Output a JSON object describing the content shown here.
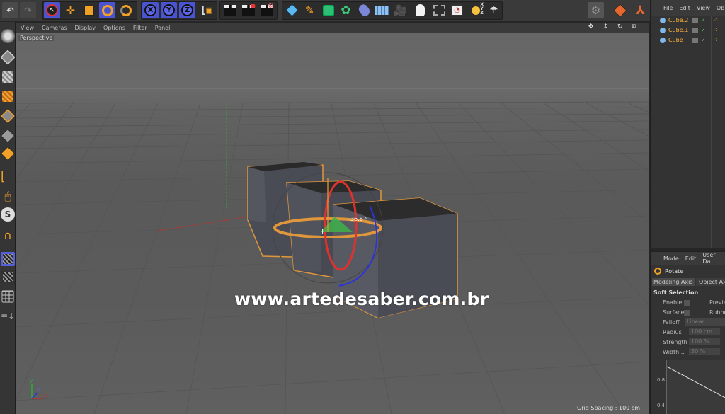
{
  "viewport": {
    "menu": [
      "View",
      "Cameras",
      "Display",
      "Options",
      "Filter",
      "Panel"
    ],
    "camera_label": "Perspective",
    "grid_spacing": "Grid Spacing : 100 cm",
    "rotation_readout": "-36.8 °",
    "watermark": "www.artedesaber.com.br",
    "axis_labels": [
      "x",
      "y",
      "z"
    ],
    "nav_icons": [
      "move-view-icon",
      "zoom-view-icon",
      "rotate-view-icon",
      "maximize-view-icon"
    ]
  },
  "toolbar": {
    "icons": [
      "undo-icon",
      "redo-icon",
      "live-selection-icon",
      "move-icon",
      "scale-icon",
      "rotate-icon",
      "recent-tool-icon",
      "x-axis-icon",
      "y-axis-icon",
      "z-axis-icon",
      "coordinate-system-icon",
      "render-view-icon",
      "render-picture-viewer-icon",
      "render-settings-icon",
      "cube-primitive-icon",
      "pen-spline-icon",
      "subdivision-surface-icon",
      "cloner-icon",
      "deformer-icon",
      "floor-icon",
      "camera-icon",
      "light-icon",
      "texture-tag-icon",
      "scene-icon",
      "xyz-icon",
      "material-icon",
      "layout-icon",
      "object-icon",
      "axis-icon"
    ],
    "axis_letters": [
      "X",
      "Y",
      "Z"
    ]
  },
  "left_toolbar": {
    "icons": [
      "make-editable-icon",
      "texture-mode-icon",
      "workplane-icon",
      "points-mode-icon",
      "edges-mode-icon",
      "polygons-mode-icon",
      "axis-mode-icon",
      "tweak-mode-icon",
      "snap-icon",
      "magnet-icon",
      "lock-workplane-icon",
      "solo-icon",
      "grid-icon",
      "stack-icon"
    ]
  },
  "object_manager": {
    "menu": [
      "File",
      "Edit",
      "View",
      "Ob"
    ],
    "objects": [
      {
        "name": "Cube.2"
      },
      {
        "name": "Cube.1"
      },
      {
        "name": "Cube"
      }
    ]
  },
  "attribute_manager": {
    "menu": [
      "Mode",
      "Edit",
      "User Da"
    ],
    "tool_name": "Rotate",
    "tabs": [
      "Modeling Axis",
      "Object Ax"
    ],
    "section": "Soft Selection",
    "fields": [
      {
        "label": "Enable",
        "value": "",
        "extra": "Previe"
      },
      {
        "label": "Surface",
        "value": "",
        "extra": "Rubbe"
      },
      {
        "label": "Falloff",
        "value": "Linear",
        "extra": ""
      },
      {
        "label": "Radius",
        "value": "100 cm",
        "extra": ""
      },
      {
        "label": "Strength",
        "value": "100 %",
        "extra": ""
      },
      {
        "label": "Width...",
        "value": "50 %",
        "extra": ""
      }
    ],
    "graph_ticks": [
      "0.8",
      "0.4"
    ]
  },
  "colors": {
    "selection_orange": "#e0973c",
    "rotate_red": "#e0322d",
    "rotate_blue": "#2d33d6",
    "rotate_green": "#3fb24a",
    "tool_blue": "#4a54d0",
    "object_label": "#ffae3a"
  }
}
